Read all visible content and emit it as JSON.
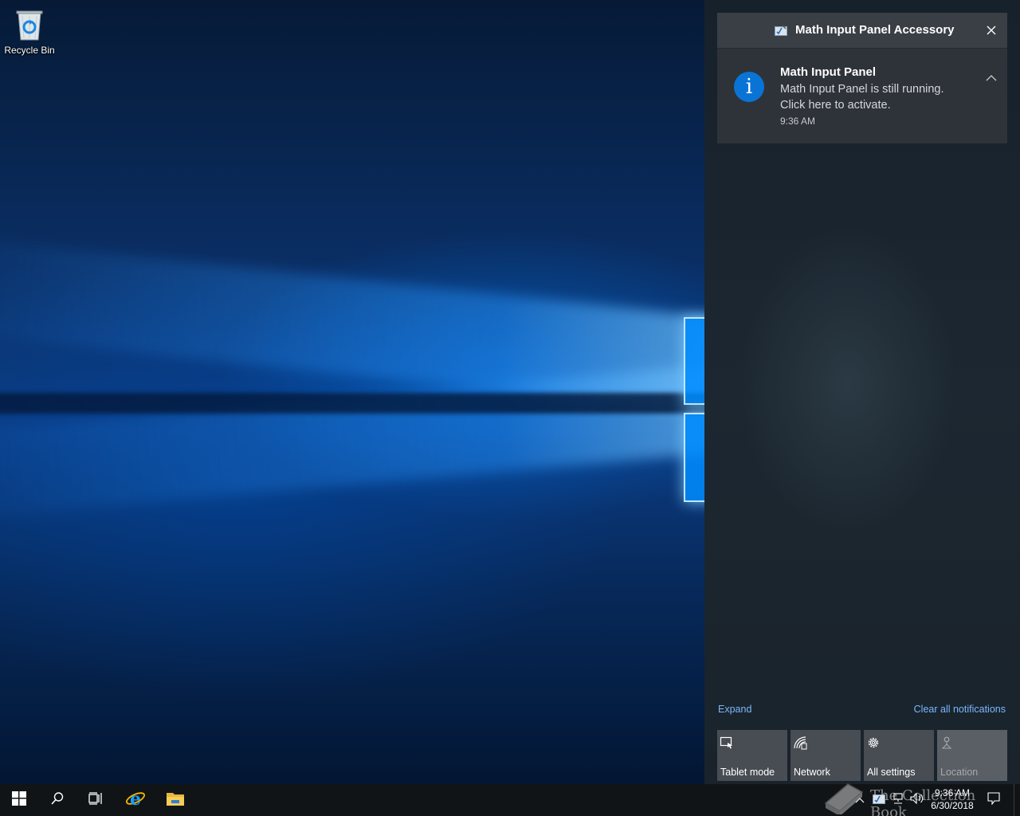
{
  "desktop": {
    "icons": [
      {
        "label": "Recycle Bin",
        "icon": "recycle-bin-icon"
      }
    ]
  },
  "action_center": {
    "group": {
      "app_name": "Math Input Panel Accessory",
      "app_icon": "math-input-panel-icon",
      "notification": {
        "title": "Math Input Panel",
        "body": "Math Input Panel is still running. Click here to activate.",
        "time": "9:36 AM",
        "icon": "info-icon",
        "icon_glyph": "i",
        "icon_color": "#0a74d6"
      }
    },
    "expand_label": "Expand",
    "clear_label": "Clear all notifications",
    "link_color": "#79b8ff",
    "quick_actions": [
      {
        "label": "Tablet mode",
        "icon": "tablet-mode-icon",
        "enabled": true
      },
      {
        "label": "Network",
        "icon": "network-icon",
        "enabled": true
      },
      {
        "label": "All settings",
        "icon": "settings-gear-icon",
        "enabled": true
      },
      {
        "label": "Location",
        "icon": "location-icon",
        "enabled": false
      }
    ]
  },
  "taskbar": {
    "pinned": [
      "start-icon",
      "search-icon",
      "task-view-icon",
      "internet-explorer-icon",
      "file-explorer-icon"
    ],
    "tray_icons": [
      "chevron-up-icon",
      "math-input-panel-tray-icon",
      "network-tray-icon",
      "volume-icon"
    ],
    "clock": {
      "time": "9:36 AM",
      "date": "6/30/2018"
    }
  },
  "watermark": {
    "text": "The Collection Book"
  }
}
